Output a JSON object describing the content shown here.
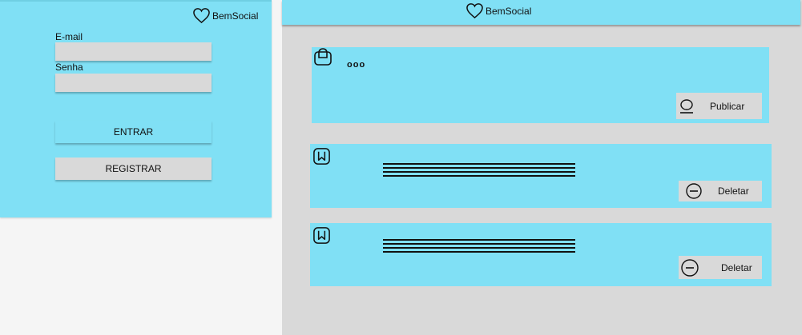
{
  "brand": {
    "name": "BemSocial"
  },
  "login": {
    "email_label": "E-mail",
    "email_value": "",
    "password_label": "Senha",
    "password_value": "",
    "enter_button": "ENTRAR",
    "register_button": "REGISTRAR"
  },
  "composer": {
    "typing_indicator": "ooo",
    "publish_button": "Publicar"
  },
  "posts": [
    {
      "delete_button": "Deletar"
    },
    {
      "delete_button": "Deletar"
    }
  ],
  "colors": {
    "panel": "#80e0f5",
    "feed_background": "#d9d9d9",
    "input": "#d9d9d9",
    "page_background": "#f5f5f5"
  },
  "icons": {
    "logo": "heart-icon",
    "composer_avatar": "bag-icon",
    "post_avatar": "bookmark-icon",
    "publish": "user-icon",
    "delete": "minus-circle-icon"
  }
}
